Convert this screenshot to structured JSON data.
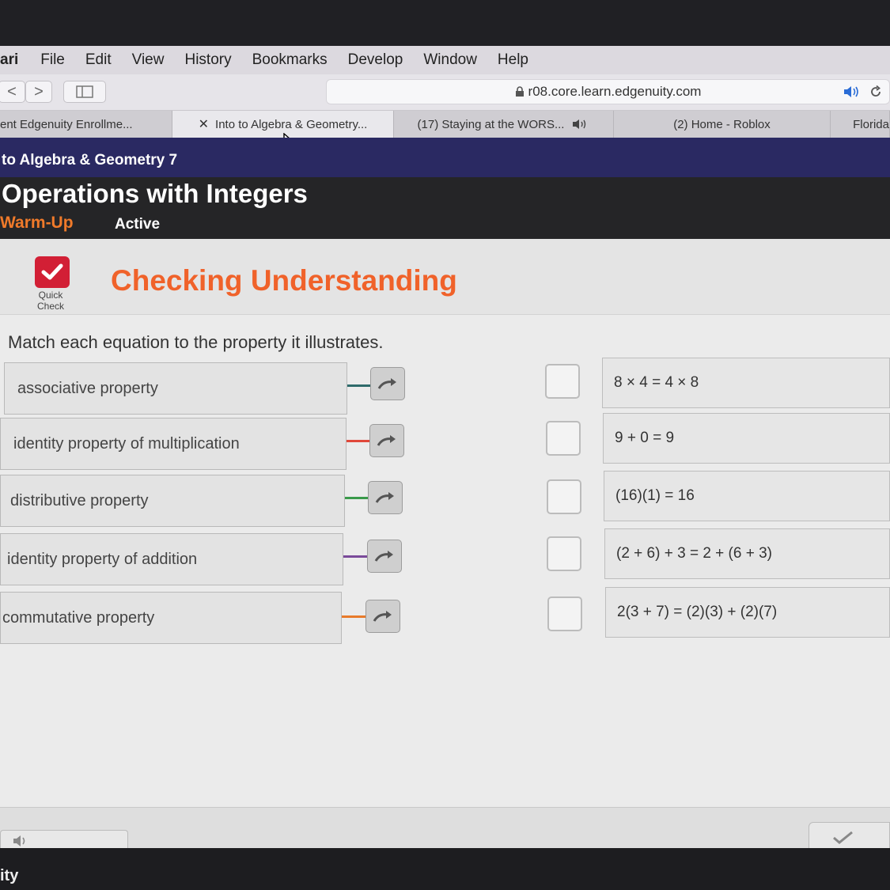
{
  "menubar": {
    "app": "ari",
    "items": [
      "File",
      "Edit",
      "View",
      "History",
      "Bookmarks",
      "Develop",
      "Window",
      "Help"
    ]
  },
  "toolbar": {
    "back_glyph": "<",
    "forward_glyph": ">",
    "url": "r08.core.learn.edgenuity.com"
  },
  "tabs": [
    {
      "label": "ent Edgenuity Enrollme...",
      "active": false
    },
    {
      "label": "Into to Algebra & Geometry...",
      "active": true
    },
    {
      "label": "(17) Staying at the WORS...",
      "active": false
    },
    {
      "label": "(2) Home - Roblox",
      "active": false
    },
    {
      "label": "Florida",
      "active": false
    }
  ],
  "course": {
    "title": "to Algebra & Geometry 7"
  },
  "lesson": {
    "title": "Operations with Integers",
    "type": "Warm-Up",
    "status": "Active"
  },
  "activity": {
    "icon_label_line1": "Quick",
    "icon_label_line2": "Check",
    "title": "Checking Understanding",
    "instruction": "Match each equation to the property it illustrates."
  },
  "terms": [
    {
      "label": "associative property",
      "color": "#2e6b6b"
    },
    {
      "label": "identity property of multiplication",
      "color": "#e0483a"
    },
    {
      "label": "distributive property",
      "color": "#3a9a4a"
    },
    {
      "label": "identity property of addition",
      "color": "#7a4a9a"
    },
    {
      "label": "commutative property",
      "color": "#e87a2a"
    }
  ],
  "equations": [
    "8 × 4 = 4 × 8",
    "9 + 0 = 9",
    "(16)(1) = 16",
    "(2 + 6) + 3 = 2 + (6 + 3)",
    "2(3 + 7) = (2)(3) + (2)(7)"
  ],
  "dock": {
    "text": "ity"
  },
  "colors": {
    "brand_orange": "#f0622a",
    "course_bar": "#2a2962",
    "quick_check_red": "#d21f35"
  }
}
